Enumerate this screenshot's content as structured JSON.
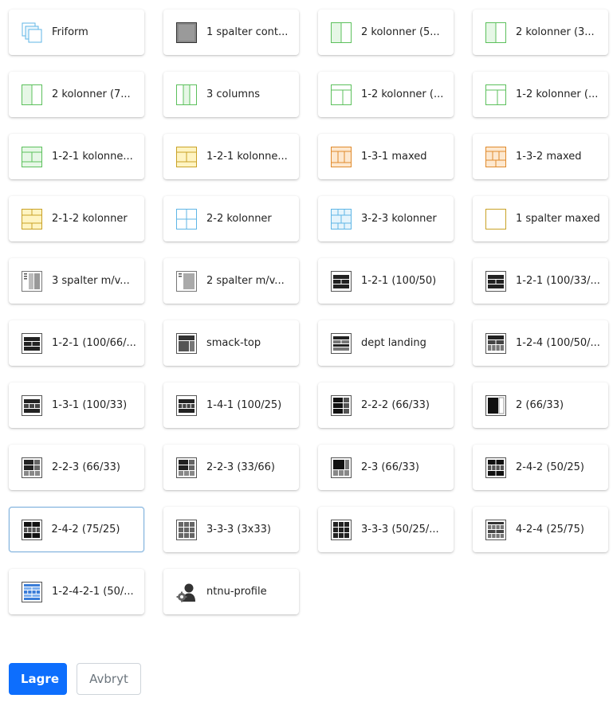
{
  "layouts": [
    {
      "label": "Friform",
      "icon": "freeform-layout-icon",
      "color": "#5fb6e6"
    },
    {
      "label": "1 spalter cont...",
      "icon": "one-column-container-icon",
      "color": "#555555"
    },
    {
      "label": "2 kolonner (5...",
      "icon": "two-columns-icon",
      "color": "#5cc05c"
    },
    {
      "label": "2 kolonner (3...",
      "icon": "two-columns-icon",
      "color": "#5cc05c"
    },
    {
      "label": "2 kolonner (7...",
      "icon": "two-columns-icon",
      "color": "#5cc05c"
    },
    {
      "label": "3 columns",
      "icon": "three-columns-icon",
      "color": "#5cc05c"
    },
    {
      "label": "1-2 kolonner (...",
      "icon": "one-two-columns-icon",
      "color": "#5cc05c"
    },
    {
      "label": "1-2 kolonner (...",
      "icon": "one-two-columns-icon",
      "color": "#5cc05c"
    },
    {
      "label": "1-2-1 kolonne...",
      "icon": "one-two-one-columns-icon",
      "color": "#5cc05c"
    },
    {
      "label": "1-2-1 kolonne...",
      "icon": "one-two-one-columns-icon",
      "color": "#c9a227"
    },
    {
      "label": "1-3-1 maxed",
      "icon": "one-three-one-maxed-icon",
      "color": "#e08a2c"
    },
    {
      "label": "1-3-2 maxed",
      "icon": "one-three-two-maxed-icon",
      "color": "#e08a2c"
    },
    {
      "label": "2-1-2 kolonner",
      "icon": "two-one-two-columns-icon",
      "color": "#c9a227"
    },
    {
      "label": "2-2 kolonner",
      "icon": "two-two-columns-icon",
      "color": "#5fb6e6"
    },
    {
      "label": "3-2-3 kolonner",
      "icon": "three-two-three-columns-icon",
      "color": "#5fb6e6"
    },
    {
      "label": "1 spalter maxed",
      "icon": "one-column-maxed-icon",
      "color": "#c9a227"
    },
    {
      "label": "3 spalter m/v...",
      "icon": "three-columns-sidebar-icon",
      "color": "#777777"
    },
    {
      "label": "2 spalter m/v...",
      "icon": "two-columns-sidebar-icon",
      "color": "#777777"
    },
    {
      "label": "1-2-1 (100/50)",
      "icon": "one-two-one-layout-icon",
      "color": "#222222"
    },
    {
      "label": "1-2-1 (100/33/...",
      "icon": "one-two-one-layout-icon",
      "color": "#222222"
    },
    {
      "label": "1-2-1 (100/66/...",
      "icon": "one-two-one-layout-icon",
      "color": "#222222"
    },
    {
      "label": "smack-top",
      "icon": "smack-top-layout-icon",
      "color": "#222222"
    },
    {
      "label": "dept landing",
      "icon": "dept-landing-layout-icon",
      "color": "#222222"
    },
    {
      "label": "1-2-4 (100/50/...",
      "icon": "one-two-four-layout-icon",
      "color": "#222222"
    },
    {
      "label": "1-3-1 (100/33)",
      "icon": "one-three-one-layout-icon",
      "color": "#222222"
    },
    {
      "label": "1-4-1 (100/25)",
      "icon": "one-four-one-layout-icon",
      "color": "#222222"
    },
    {
      "label": "2-2-2 (66/33)",
      "icon": "two-two-two-layout-icon",
      "color": "#222222"
    },
    {
      "label": "2 (66/33)",
      "icon": "two-column-layout-icon",
      "color": "#222222"
    },
    {
      "label": "2-2-3 (66/33)",
      "icon": "two-two-three-layout-icon",
      "color": "#222222"
    },
    {
      "label": "2-2-3 (33/66)",
      "icon": "two-two-three-layout-icon",
      "color": "#222222"
    },
    {
      "label": "2-3 (66/33)",
      "icon": "two-three-layout-icon",
      "color": "#222222"
    },
    {
      "label": "2-4-2 (50/25)",
      "icon": "two-four-two-layout-icon",
      "color": "#222222"
    },
    {
      "label": "2-4-2 (75/25)",
      "icon": "two-four-two-layout-icon",
      "color": "#222222",
      "selected": true
    },
    {
      "label": "3-3-3 (3x33)",
      "icon": "three-three-three-layout-icon",
      "color": "#666666"
    },
    {
      "label": "3-3-3 (50/25/...",
      "icon": "three-three-three-layout-icon",
      "color": "#222222"
    },
    {
      "label": "4-2-4 (25/75)",
      "icon": "four-two-four-layout-icon",
      "color": "#444444"
    },
    {
      "label": "1-2-4-2-1 (50/...",
      "icon": "one-two-four-two-one-layout-icon",
      "color": "#3b7dd8"
    },
    {
      "label": "ntnu-profile",
      "icon": "user-gear-icon",
      "color": "#333333"
    }
  ],
  "buttons": {
    "save": "Lagre",
    "cancel": "Avbryt"
  }
}
